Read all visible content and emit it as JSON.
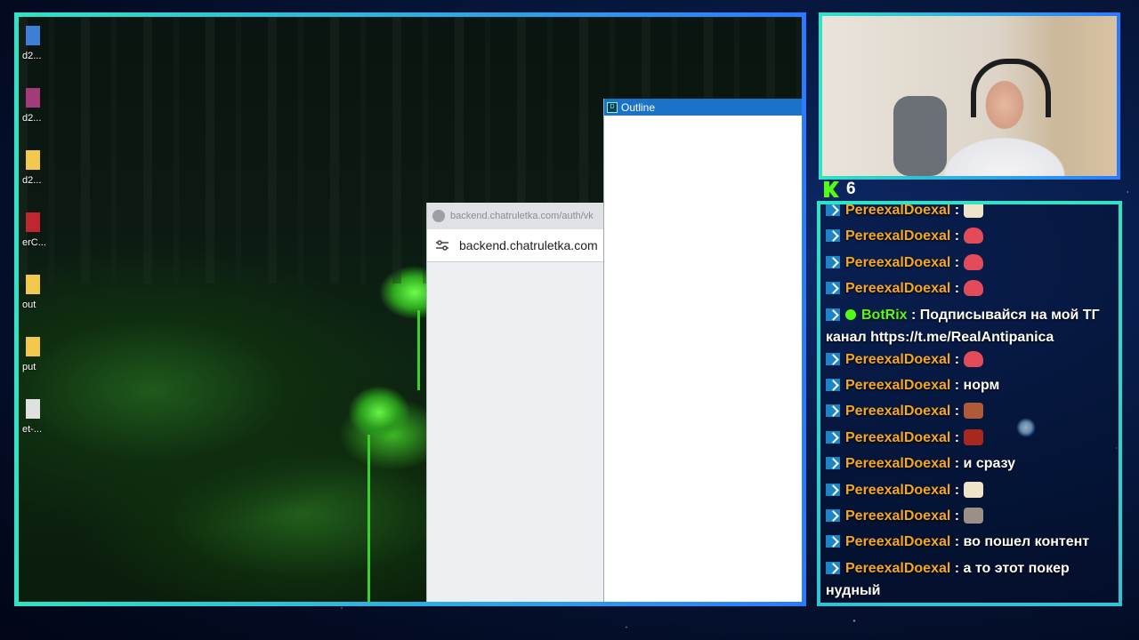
{
  "desktop": {
    "icons": [
      {
        "label": "d2...",
        "icon": "d2-shortcut-icon",
        "color": "#3d7fd6"
      },
      {
        "label": "d2...",
        "icon": "winrar-archive-icon",
        "color": "#a33a7a"
      },
      {
        "label": "d2...",
        "icon": "folder-icon",
        "color": "#f2c94c"
      },
      {
        "label": "erC...",
        "icon": "app-shortcut-icon",
        "color": "#c0262e"
      },
      {
        "label": "out",
        "icon": "folder-icon",
        "color": "#f2c94c"
      },
      {
        "label": "put",
        "icon": "folder-icon",
        "color": "#f2c94c"
      },
      {
        "label": "et-...",
        "icon": "document-icon",
        "color": "#e0e0e0"
      }
    ]
  },
  "browser": {
    "tab_url": "backend.chatruletka.com/auth/vk",
    "address": "backend.chatruletka.com"
  },
  "outline_window": {
    "title": "Outline"
  },
  "stream": {
    "viewer_count": "6",
    "chat": [
      {
        "user": "PereexalDoexal",
        "sep": " : ",
        "text": "",
        "emote": "pepe"
      },
      {
        "user": "PereexalDoexal",
        "sep": " : ",
        "text": "",
        "emote": "blob"
      },
      {
        "user": "PereexalDoexal",
        "sep": " : ",
        "text": "",
        "emote": "blob"
      },
      {
        "user": "PereexalDoexal",
        "sep": " : ",
        "text": "",
        "emote": "blob"
      },
      {
        "user": "BotRix",
        "bot": true,
        "sep": " : ",
        "text": "Подписывайся на мой ТГ канал https://t.me/RealAntipanica",
        "emote": ""
      },
      {
        "user": "PereexalDoexal",
        "sep": " : ",
        "text": "",
        "emote": "blob"
      },
      {
        "user": "PereexalDoexal",
        "sep": " : ",
        "text": "норм",
        "emote": ""
      },
      {
        "user": "PereexalDoexal",
        "sep": " : ",
        "text": "",
        "emote": "face"
      },
      {
        "user": "PereexalDoexal",
        "sep": " : ",
        "text": "",
        "emote": "angry"
      },
      {
        "user": "PereexalDoexal",
        "sep": " : ",
        "text": "и сразу",
        "emote": ""
      },
      {
        "user": "PereexalDoexal",
        "sep": " : ",
        "text": "",
        "emote": "pepe"
      },
      {
        "user": "PereexalDoexal",
        "sep": " : ",
        "text": "",
        "emote": "cat"
      },
      {
        "user": "PereexalDoexal",
        "sep": " : ",
        "text": "во пошел контент",
        "emote": ""
      },
      {
        "user": "PereexalDoexal",
        "sep": " : ",
        "text": "а то этот покер нудный",
        "emote": ""
      }
    ]
  },
  "colors": {
    "frame_gradient_start": "#2fe3c4",
    "frame_gradient_end": "#2b7bff",
    "username": "#f5a623",
    "bot_username": "#53fc18",
    "kick_green": "#53fc18",
    "outline_titlebar": "#1b73c9"
  }
}
